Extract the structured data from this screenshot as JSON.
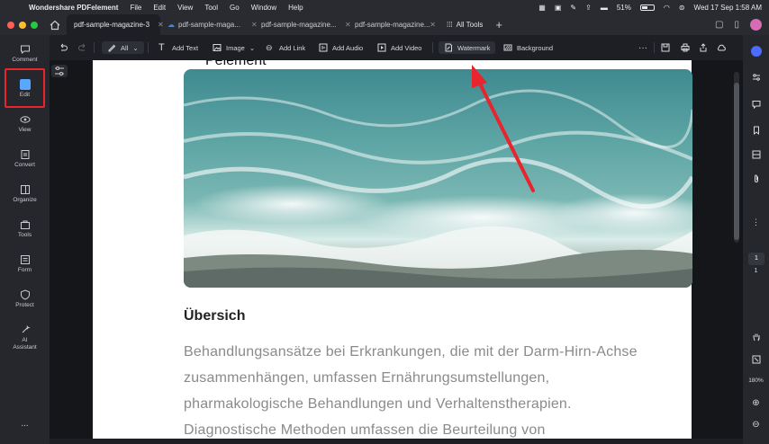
{
  "menubar": {
    "app_name": "Wondershare PDFelement",
    "items": [
      "File",
      "Edit",
      "View",
      "Tool",
      "Go",
      "Window",
      "Help"
    ],
    "battery": "51%",
    "datetime": "Wed 17 Sep  1:58 AM"
  },
  "tabs": [
    {
      "label": "pdf-sample-magazine-3",
      "active": true
    },
    {
      "label": "pdf-sample-maga...",
      "active": false,
      "cloud": true
    },
    {
      "label": "pdf-sample-magazine...",
      "active": false
    },
    {
      "label": "pdf-sample-magazine...",
      "active": false
    }
  ],
  "all_tools_label": "All Tools",
  "sidebar": {
    "items": [
      {
        "label": "Comment",
        "icon": "comment-icon"
      },
      {
        "label": "Edit",
        "icon": "edit-icon"
      },
      {
        "label": "View",
        "icon": "eye-icon"
      },
      {
        "label": "Convert",
        "icon": "convert-icon"
      },
      {
        "label": "Organize",
        "icon": "organize-icon"
      },
      {
        "label": "Tools",
        "icon": "toolbox-icon"
      },
      {
        "label": "Form",
        "icon": "form-icon"
      },
      {
        "label": "Protect",
        "icon": "shield-icon"
      },
      {
        "label": "AI Assistant",
        "icon": "sparkle-icon"
      }
    ],
    "more": "..."
  },
  "toolbar": {
    "all_label": "All",
    "add_text": "Add Text",
    "image": "Image",
    "add_link": "Add Link",
    "add_audio": "Add Audio",
    "add_video": "Add Video",
    "watermark": "Watermark",
    "background": "Background"
  },
  "document": {
    "top_text": "Pelement",
    "heading": "Übersich",
    "paragraph_lines": [
      "Behandlungsansätze bei Erkrankungen, die mit der Darm-Hirn-Achse",
      "zusammenhängen, umfassen Ernährungsumstellungen,",
      "pharmakologische Behandlungen und Verhaltenstherapien.",
      "Diagnostische Methoden umfassen die Beurteilung von"
    ]
  },
  "right_panel": {
    "current_page": "1",
    "total_pages": "1",
    "zoom": "180%"
  },
  "colors": {
    "highlight_red": "#e8242d",
    "accent_blue": "#5aa7ff",
    "background": "#1e1f24"
  }
}
